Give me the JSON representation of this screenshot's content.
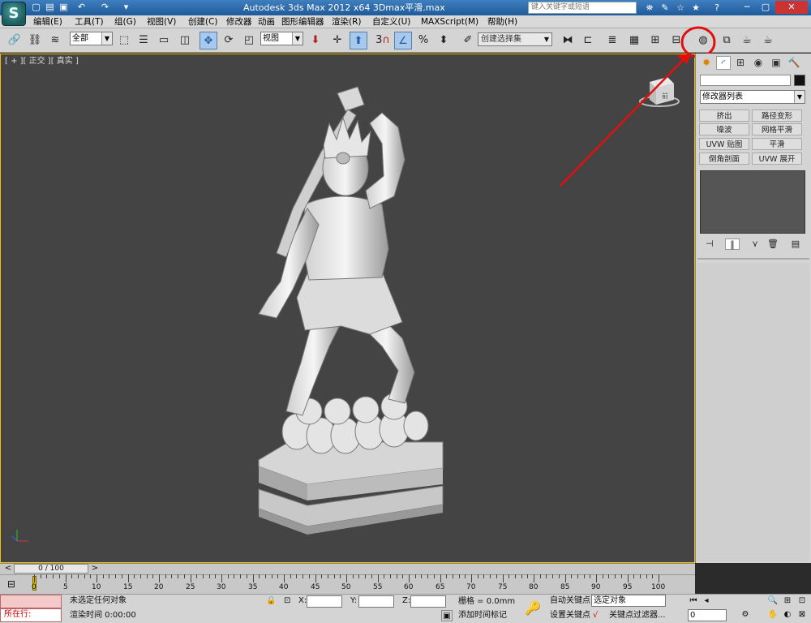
{
  "titlebar": {
    "app_logo": "S",
    "title": "Autodesk 3ds Max  2012 x64     3Dmax平滑.max",
    "search_placeholder": "键入关键字或短语"
  },
  "menu": [
    "编辑(E)",
    "工具(T)",
    "组(G)",
    "视图(V)",
    "创建(C)",
    "修改器",
    "动画",
    "图形编辑器",
    "渲染(R)",
    "自定义(U)",
    "MAXScript(M)",
    "帮助(H)"
  ],
  "toolbar": {
    "selection_filter": "全部",
    "reference_coord": "视图",
    "named_selection_set": "创建选择集",
    "snap_number": "3",
    "percent_symbol": "%"
  },
  "viewport": {
    "label": "[ + ][ 正交 ][ 真实 ]",
    "viewcube_face": "前"
  },
  "command_panel": {
    "modifier_list": "修改器列表",
    "modifier_buttons": [
      "挤出",
      "路径变形",
      "噪波",
      "网格平滑",
      "UVW 贴图",
      "平滑",
      "倒角剖面",
      "UVW 展开"
    ]
  },
  "timeline": {
    "frame_display": "0 / 100",
    "prev_arrow": "<",
    "next_arrow": ">",
    "ticks": [
      "0",
      "5",
      "10",
      "15",
      "20",
      "25",
      "30",
      "35",
      "40",
      "45",
      "50",
      "55",
      "60",
      "65",
      "70",
      "75",
      "80",
      "85",
      "90",
      "95",
      "100"
    ]
  },
  "statusbar": {
    "listener_text": "所在行:",
    "selection_status": "未选定任何对象",
    "render_time": "渲染时间 0:00:00",
    "x_label": "X:",
    "y_label": "Y:",
    "z_label": "Z:",
    "grid": "栅格 = 0.0mm",
    "add_time_tag": "添加时间标记",
    "auto_key": "自动关键点",
    "set_key": "设置关键点",
    "selected_object": "选定对象",
    "key_filters": "关键点过滤器...",
    "frame_field": "0"
  },
  "colors": {
    "annotation_red": "#e01010",
    "viewport_active_border": "#f0c000",
    "viewport_bg": "#444444"
  },
  "icons": {
    "snap_toggle": "3-magnet-icon",
    "highlighted_tool": "render-setup-teapot-icon"
  }
}
